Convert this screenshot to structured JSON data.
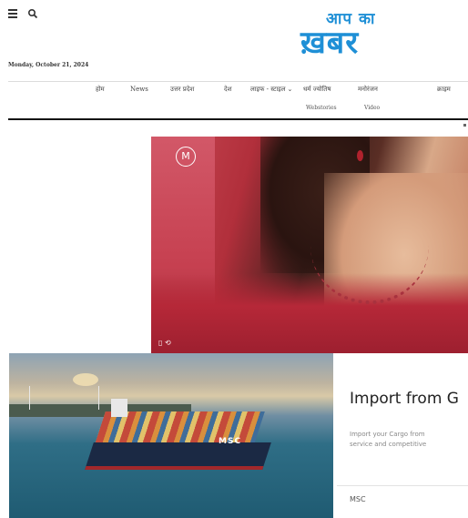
{
  "header": {
    "menu_icon": "hamburger-menu-icon",
    "search_icon": "search-icon",
    "logo_top": "आप का",
    "logo_main": "ख़बर",
    "date": "Monday, October 21, 2024"
  },
  "nav": {
    "items": [
      {
        "label": "होम"
      },
      {
        "label": "News"
      },
      {
        "label": "उत्तर प्रदेश"
      },
      {
        "label": "देश"
      },
      {
        "label": "लाइफ - स्टाइल"
      },
      {
        "label": "धर्म ज्योतिष"
      },
      {
        "label": "मनोरंजन"
      },
      {
        "label": "क्राइम"
      }
    ],
    "sub_items": [
      {
        "label": "Webstories"
      },
      {
        "label": "Video"
      }
    ]
  },
  "video_ad": {
    "brand_mark": "M",
    "controls": "▯ ⟲"
  },
  "native_ad": {
    "title": "Import from G",
    "desc_line1": "Import your Cargo from",
    "desc_line2": "service and competitive",
    "brand": "MSC",
    "ship_label": "MSC"
  },
  "colors": {
    "logo_blue": "#1e8fd6",
    "rule": "#111111"
  }
}
